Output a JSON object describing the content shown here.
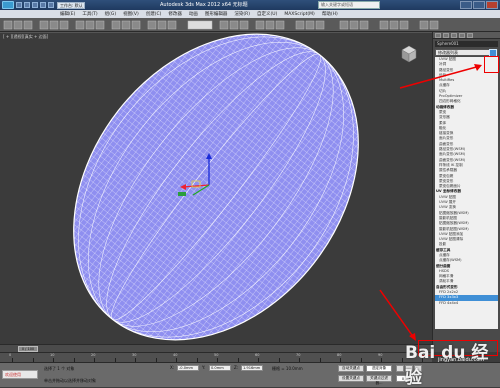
{
  "window": {
    "title": "Autodesk 3ds Max  2012 x64     无标题",
    "quick_access_dropdown": "工作台: 默认",
    "search_placeholder": "输入关键字或短语"
  },
  "menu": [
    "编辑(E)",
    "工具(T)",
    "组(G)",
    "视图(V)",
    "创建(C)",
    "修改器",
    "动画",
    "图形编辑器",
    "渲染(R)",
    "自定义(U)",
    "MAXScript(M)",
    "帮助(H)"
  ],
  "viewport": {
    "label": "[ + ][透视][真实 + 边面]",
    "mesh_color": "#8f8ff0",
    "wire_color": "#ffffff"
  },
  "command_panel": {
    "object_name": "Sphere001",
    "modifier_list_label": "修改器列表",
    "items": [
      {
        "label": "UVW 贴图",
        "type": "item"
      },
      {
        "label": "补洞",
        "type": "item"
      },
      {
        "label": "路径变形",
        "type": "item"
      },
      {
        "label": "优化",
        "type": "item"
      },
      {
        "label": "MultiRes",
        "type": "item"
      },
      {
        "label": "点缓存",
        "type": "item"
      },
      {
        "label": "切片",
        "type": "item"
      },
      {
        "label": "ProOptimizer",
        "type": "item"
      },
      {
        "label": "四边形网格化",
        "type": "item"
      },
      {
        "label": "动画修改器",
        "type": "header"
      },
      {
        "label": "蒙皮",
        "type": "item"
      },
      {
        "label": "变形器",
        "type": "item"
      },
      {
        "label": "柔体",
        "type": "item"
      },
      {
        "label": "融化",
        "type": "item"
      },
      {
        "label": "链接变换",
        "type": "item"
      },
      {
        "label": "面片变形",
        "type": "item"
      },
      {
        "label": "曲面变形",
        "type": "item"
      },
      {
        "label": "路径变形(WSM)",
        "type": "item"
      },
      {
        "label": "面片变形(WSM)",
        "type": "item"
      },
      {
        "label": "曲面变形(WSM)",
        "type": "item"
      },
      {
        "label": "样条线 IK 控制",
        "type": "item"
      },
      {
        "label": "属性承载器",
        "type": "item"
      },
      {
        "label": "蒙皮包裹",
        "type": "item"
      },
      {
        "label": "蒙皮变形",
        "type": "item"
      },
      {
        "label": "蒙皮包裹面片",
        "type": "item"
      },
      {
        "label": "UV 坐标修改器",
        "type": "header"
      },
      {
        "label": "UVW 贴图",
        "type": "item"
      },
      {
        "label": "UVW 展开",
        "type": "item"
      },
      {
        "label": "UVW 变换",
        "type": "item"
      },
      {
        "label": "贴图缩放器(WSM)",
        "type": "item"
      },
      {
        "label": "摄影机贴图",
        "type": "item"
      },
      {
        "label": "贴图缩放器(WSM)",
        "type": "item"
      },
      {
        "label": "摄影机贴图(WSM)",
        "type": "item"
      },
      {
        "label": "UVW 贴图添加",
        "type": "item"
      },
      {
        "label": "UVW 贴图清除",
        "type": "item"
      },
      {
        "label": "投影",
        "type": "item"
      },
      {
        "label": "缓存工具",
        "type": "header"
      },
      {
        "label": "点缓存",
        "type": "item"
      },
      {
        "label": "点缓存(WSM)",
        "type": "item"
      },
      {
        "label": "细分曲面",
        "type": "header"
      },
      {
        "label": "HSDS",
        "type": "item"
      },
      {
        "label": "网格平滑",
        "type": "item"
      },
      {
        "label": "涡轮平滑",
        "type": "item"
      },
      {
        "label": "自由形式变形",
        "type": "header"
      },
      {
        "label": "FFD 2x2x2",
        "type": "item"
      },
      {
        "label": "FFD 3x3x3",
        "type": "highlight"
      },
      {
        "label": "FFD 4x4x4",
        "type": "item"
      }
    ]
  },
  "timeline": {
    "slider_label": "0 / 100",
    "ticks": [
      "0",
      "10",
      "20",
      "30",
      "40",
      "50",
      "60",
      "70",
      "80",
      "90",
      "100"
    ]
  },
  "status": {
    "mode_button": "欢迎使用",
    "selection_text": "选择了 1 个 对象",
    "prompt_text": "单击并拖动以选择并移动对象",
    "x_label": "X:",
    "x_value": "-0.0mm",
    "y_label": "Y:",
    "y_value": "0.0mm",
    "z_label": "Z:",
    "z_value": "1.916mm",
    "grid_text": "栅格 = 10.0mm",
    "autokey_button": "自动关键点",
    "setkey_button": "设置关键点",
    "selected_dropdown": "选定对象",
    "keyfilter_button": "关键点过滤器...",
    "frame_value": "0"
  },
  "watermark": {
    "text": "Bai du 经验",
    "sub": "jingyan.baidu.com"
  }
}
